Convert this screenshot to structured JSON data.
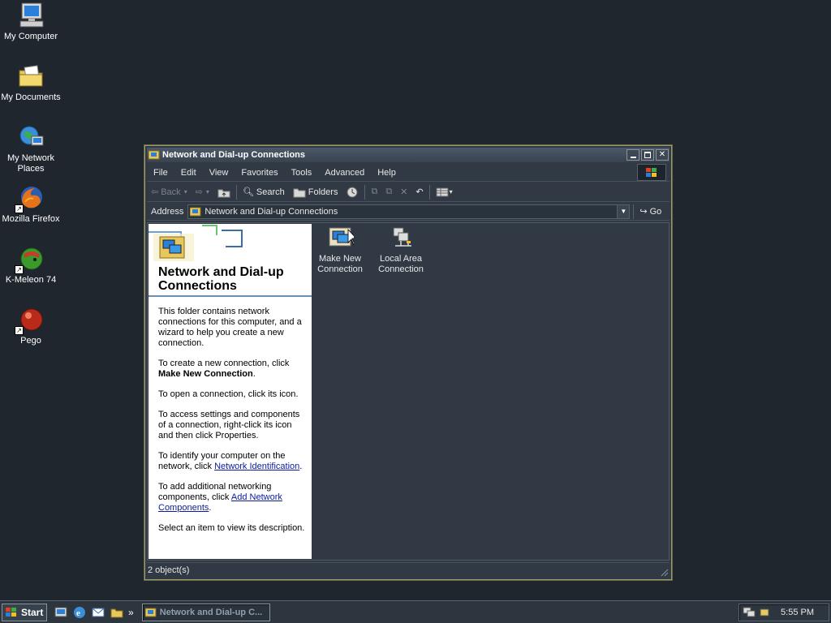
{
  "desktop": {
    "icons": [
      {
        "label": "My Computer"
      },
      {
        "label": "My Documents"
      },
      {
        "label": "My Network Places"
      },
      {
        "label": "Mozilla Firefox"
      },
      {
        "label": "K-Meleon 74"
      },
      {
        "label": "Pego"
      }
    ]
  },
  "window": {
    "title": "Network and Dial-up Connections",
    "menu": [
      "File",
      "Edit",
      "View",
      "Favorites",
      "Tools",
      "Advanced",
      "Help"
    ],
    "toolbar": {
      "back": "Back",
      "search": "Search",
      "folders": "Folders"
    },
    "address": {
      "label": "Address",
      "value": "Network and Dial-up Connections",
      "go": "Go"
    },
    "left_pane": {
      "title": "Network and Dial-up Connections",
      "p1": "This folder contains network connections for this computer, and a wizard to help you create a new connection.",
      "p2_pre": "To create a new connection, click",
      "p2_bold": "Make New Connection",
      "p2_post": ".",
      "p3": "To open a connection, click its icon.",
      "p4": "To access settings and components of a connection, right-click its icon and then click Properties.",
      "p5_pre": "To identify your computer on the network, click",
      "p5_link": "Network Identification",
      "p5_post": ".",
      "p6_pre": "To add additional networking components, click",
      "p6_link": "Add Network Components",
      "p6_post": ".",
      "p7": "Select an item to view its description."
    },
    "items": [
      {
        "label": "Make New Connection"
      },
      {
        "label": "Local Area Connection"
      }
    ],
    "status": "2 object(s)"
  },
  "taskbar": {
    "start": "Start",
    "task_label": "Network and Dial-up C...",
    "clock": "5:55 PM",
    "chevron": "»"
  },
  "colors": {
    "desktop": "#1f262e",
    "window_bg": "#313a44",
    "link": "#0a1c9c"
  }
}
